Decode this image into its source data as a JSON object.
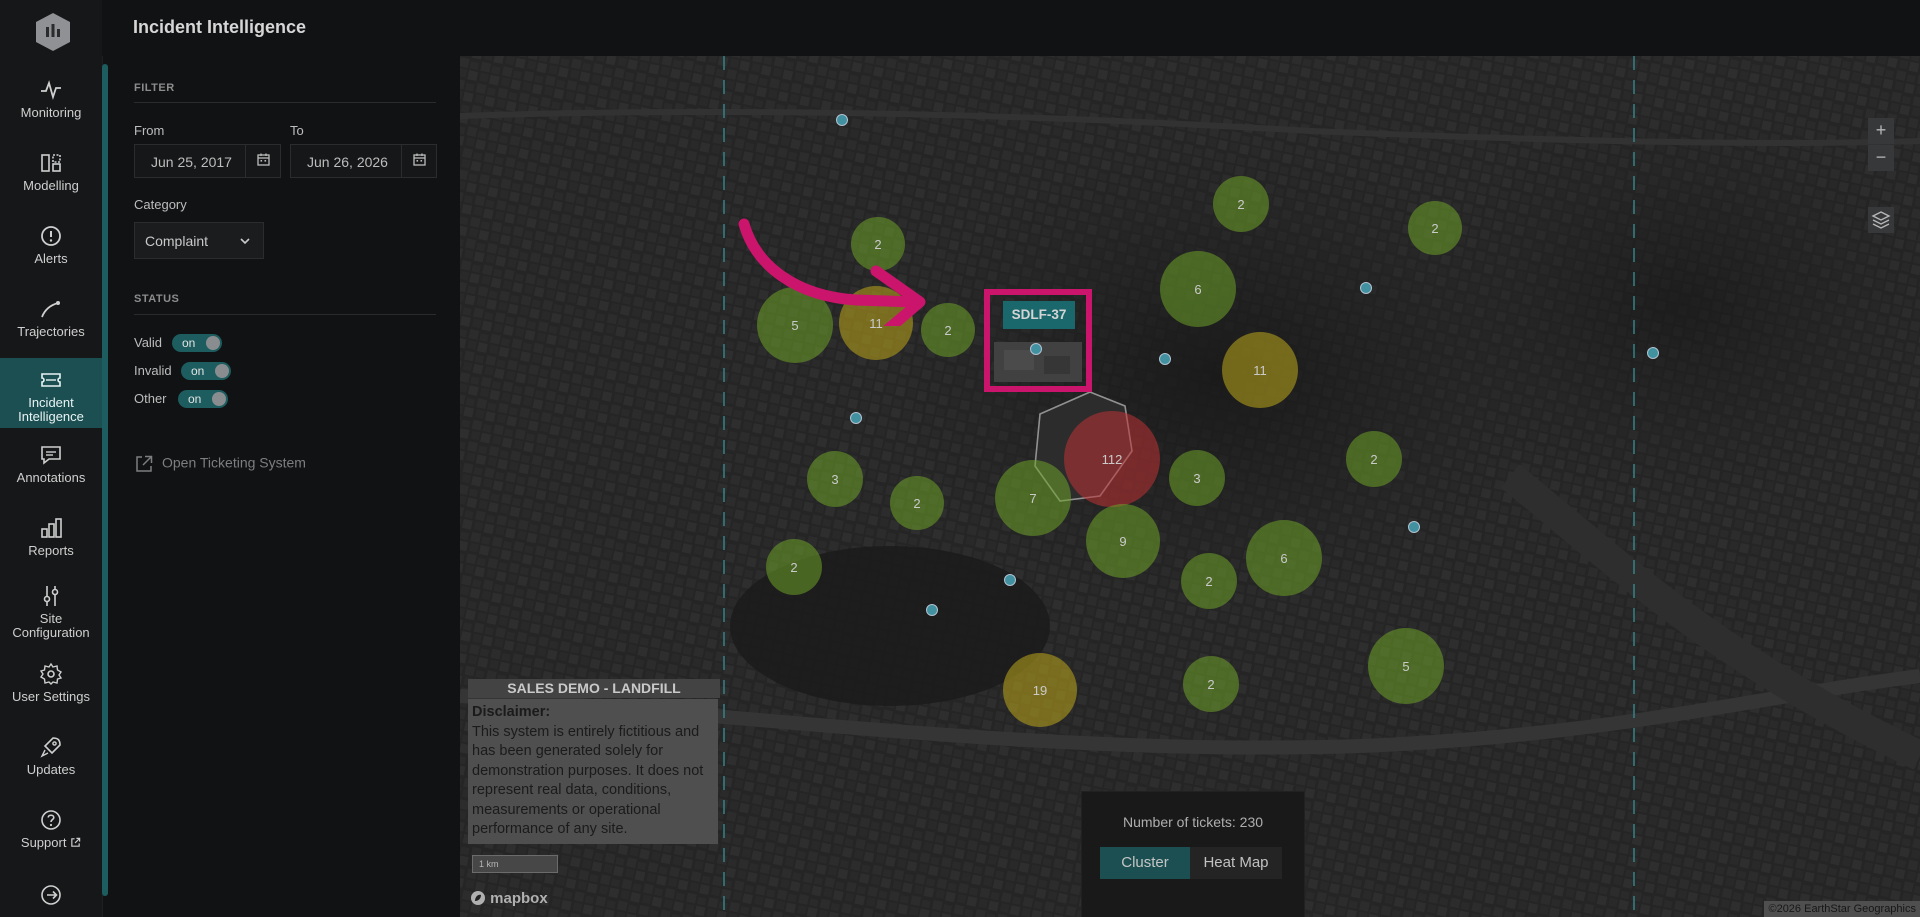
{
  "app": {
    "title": "Incident Intelligence"
  },
  "sidebar": {
    "items": [
      {
        "label": "Monitoring",
        "icon": "monitoring-icon"
      },
      {
        "label": "Modelling",
        "icon": "modelling-icon"
      },
      {
        "label": "Alerts",
        "icon": "alert-icon"
      },
      {
        "label": "Trajectories",
        "icon": "trajectory-icon"
      },
      {
        "label": "Incident Intelligence",
        "icon": "ticket-icon",
        "active": true
      },
      {
        "label": "Annotations",
        "icon": "annotation-icon"
      },
      {
        "label": "Reports",
        "icon": "reports-icon"
      },
      {
        "label": "Site Configuration",
        "icon": "sliders-icon"
      },
      {
        "label": "User Settings",
        "icon": "gear-icon"
      },
      {
        "label": "Updates",
        "icon": "rocket-icon"
      },
      {
        "label": "Support",
        "icon": "help-icon"
      }
    ]
  },
  "filter": {
    "section_title": "FILTER",
    "from_label": "From",
    "from_value": "Jun 25, 2017",
    "to_label": "To",
    "to_value": "Jun 26, 2026",
    "category_label": "Category",
    "category_value": "Complaint"
  },
  "status": {
    "section_title": "STATUS",
    "toggles": [
      {
        "label": "Valid",
        "state": "on"
      },
      {
        "label": "Invalid",
        "state": "on"
      },
      {
        "label": "Other",
        "state": "on"
      }
    ]
  },
  "links": {
    "ticketing": "Open Ticketing System"
  },
  "map": {
    "selected_ticket": "SDLF-37",
    "clusters": [
      {
        "count": "2",
        "color": "green"
      },
      {
        "count": "5",
        "color": "green"
      },
      {
        "count": "11",
        "color": "yellow"
      },
      {
        "count": "2",
        "color": "green"
      },
      {
        "count": "2",
        "color": "green"
      },
      {
        "count": "6",
        "color": "green"
      },
      {
        "count": "2",
        "color": "green"
      },
      {
        "count": "11",
        "color": "yellow"
      },
      {
        "count": "112",
        "color": "red"
      },
      {
        "count": "3",
        "color": "green"
      },
      {
        "count": "2",
        "color": "green"
      },
      {
        "count": "7",
        "color": "green"
      },
      {
        "count": "3",
        "color": "green"
      },
      {
        "count": "9",
        "color": "green"
      },
      {
        "count": "2",
        "color": "green"
      },
      {
        "count": "6",
        "color": "green"
      },
      {
        "count": "2",
        "color": "green"
      },
      {
        "count": "2",
        "color": "green"
      },
      {
        "count": "19",
        "color": "yellow"
      },
      {
        "count": "2",
        "color": "green"
      },
      {
        "count": "5",
        "color": "green"
      }
    ],
    "disclaimer_title": "SALES DEMO - LANDFILL",
    "disclaimer_heading": "Disclaimer:",
    "disclaimer_text": "This system is entirely fictitious and has been generated solely for demonstration purposes. It does not represent real data, conditions, measurements or operational performance of any site.",
    "scale_label": "1 km",
    "mapbox_label": "mapbox",
    "attribution": "©2026 EarthStar Geographics",
    "tickets_label": "Number of tickets: 230",
    "view_modes": [
      "Cluster",
      "Heat Map"
    ],
    "active_view": "Cluster"
  },
  "colors": {
    "accent": "#1d5d60",
    "highlight": "#e8177a",
    "cluster_green": "#7bb82e",
    "cluster_yellow": "#c9b320",
    "cluster_red": "#d9383a"
  }
}
